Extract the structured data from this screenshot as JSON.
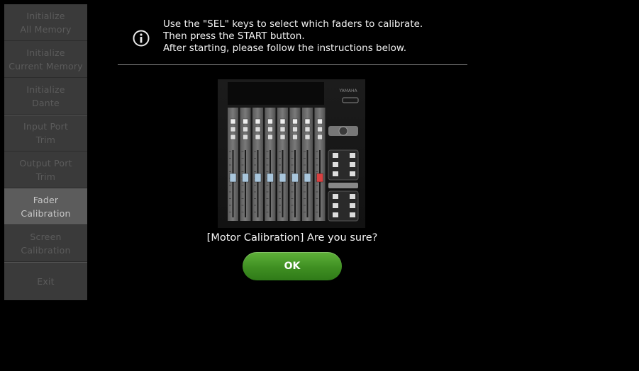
{
  "sidebar": {
    "items": [
      {
        "label": "Initialize\nAll Memory",
        "active": false
      },
      {
        "label": "Initialize\nCurrent Memory",
        "active": false
      },
      {
        "label": "Initialize\nDante",
        "active": false
      },
      {
        "label": "Input Port\nTrim",
        "active": false
      },
      {
        "label": "Output Port\nTrim",
        "active": false
      },
      {
        "label": "Fader\nCalibration",
        "active": true
      },
      {
        "label": "Screen\nCalibration",
        "active": false
      },
      {
        "label": "Exit",
        "active": false
      }
    ]
  },
  "dialog": {
    "info_lines": [
      "Use the \"SEL\" keys to select which faders to calibrate.",
      "Then press the START button.",
      "After starting, please follow the instructions below."
    ],
    "icon": "info-icon",
    "device_image": "fader-panel-illustration",
    "question": "[Motor Calibration] Are you sure?",
    "ok_label": "OK"
  },
  "colors": {
    "background": "#000000",
    "sidebar": "#3a3a3a",
    "sidebar_active": "#5c5c5c",
    "ok_button": "#4a9e2c",
    "fader_highlight": "#d94040"
  }
}
